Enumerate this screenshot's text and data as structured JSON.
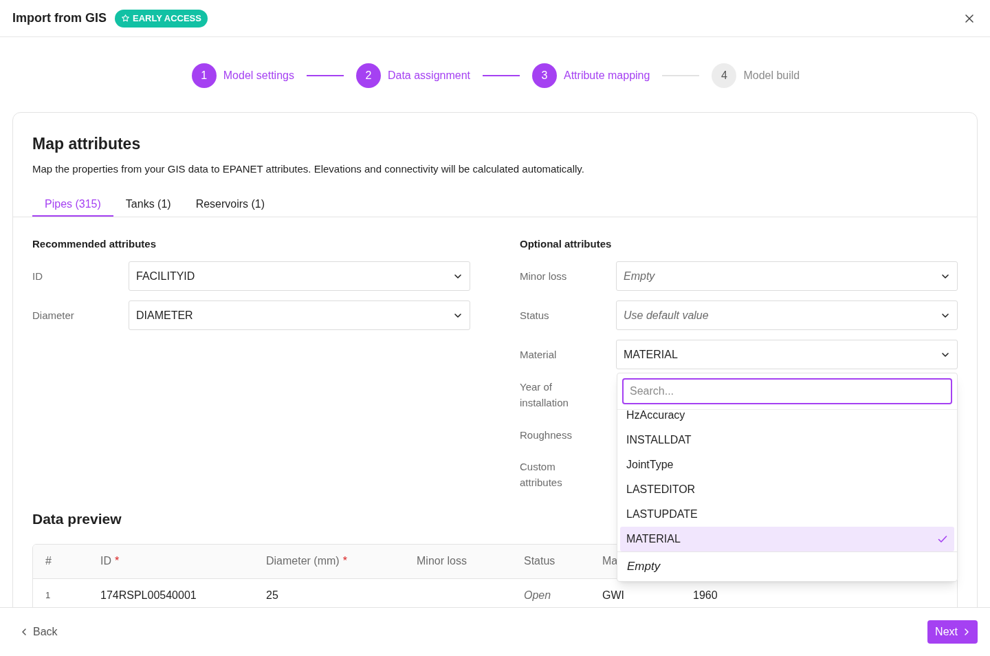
{
  "window": {
    "title": "Import from GIS",
    "badge": "EARLY ACCESS"
  },
  "steps": [
    {
      "number": "1",
      "label": "Model settings",
      "active": true
    },
    {
      "number": "2",
      "label": "Data assignment",
      "active": true
    },
    {
      "number": "3",
      "label": "Attribute mapping",
      "active": true
    },
    {
      "number": "4",
      "label": "Model build",
      "active": false
    }
  ],
  "card": {
    "title": "Map attributes",
    "description": "Map the properties from your GIS data to EPANET attributes. Elevations and connectivity will be calculated automatically."
  },
  "tabs": [
    {
      "label": "Pipes (315)",
      "selected": true
    },
    {
      "label": "Tanks (1)",
      "selected": false
    },
    {
      "label": "Reservoirs (1)",
      "selected": false
    }
  ],
  "recommended": {
    "heading": "Recommended attributes",
    "rows": [
      {
        "label": "ID",
        "value": "FACILITYID",
        "kind": "value"
      },
      {
        "label": "Diameter",
        "value": "DIAMETER",
        "kind": "value"
      }
    ]
  },
  "optional": {
    "heading": "Optional attributes",
    "rows": [
      {
        "label": "Minor loss",
        "value": "Empty",
        "kind": "default"
      },
      {
        "label": "Status",
        "value": "Use default value",
        "kind": "default"
      },
      {
        "label": "Material",
        "value": "MATERIAL",
        "kind": "value"
      },
      {
        "label": "Year of installation"
      },
      {
        "label": "Roughness"
      },
      {
        "label": "Custom attributes"
      }
    ]
  },
  "dropdown": {
    "placeholder": "Search...",
    "options": [
      {
        "label": "HzAccuracy",
        "selected": false,
        "kind": "field"
      },
      {
        "label": "INSTALLDAT",
        "selected": false,
        "kind": "field"
      },
      {
        "label": "JointType",
        "selected": false,
        "kind": "field"
      },
      {
        "label": "LASTEDITOR",
        "selected": false,
        "kind": "field"
      },
      {
        "label": "LASTUPDATE",
        "selected": false,
        "kind": "field"
      },
      {
        "label": "MATERIAL",
        "selected": true,
        "kind": "field"
      },
      {
        "label": "Empty",
        "selected": false,
        "kind": "empty"
      }
    ]
  },
  "preview": {
    "heading": "Data preview",
    "columns": [
      {
        "label": "#"
      },
      {
        "label": "ID",
        "marker": "*"
      },
      {
        "label": "Diameter (mm)",
        "marker": "*"
      },
      {
        "label": "Minor loss"
      },
      {
        "label": "Status"
      },
      {
        "label": "Ma"
      }
    ],
    "rows": [
      {
        "index": "1",
        "id": "174RSPL00540001",
        "diameter": "25",
        "status": "Open",
        "material": "GWI",
        "column_7": "1960"
      }
    ]
  },
  "footer": {
    "back": "Back",
    "next": "Next"
  }
}
